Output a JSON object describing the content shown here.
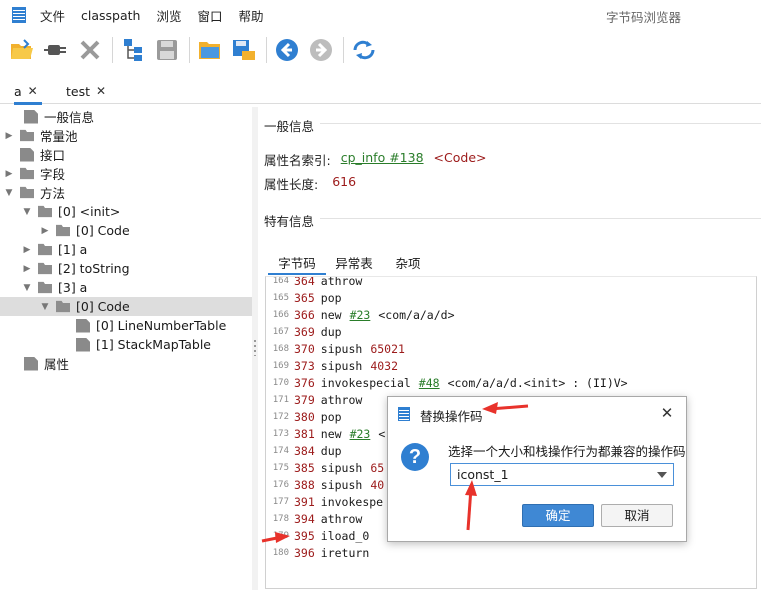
{
  "menu": {
    "items": [
      "文件",
      "classpath",
      "浏览",
      "窗口",
      "帮助"
    ],
    "title": "字节码浏览器"
  },
  "toolbar": {
    "buttons": [
      "open-folder-icon",
      "plugin-icon",
      "close-icon",
      "tree-icon",
      "save-icon",
      "folder-open-icon",
      "save-as-icon",
      "back-icon",
      "forward-icon",
      "refresh-icon"
    ]
  },
  "tabs": [
    {
      "label": "a",
      "close": "✕"
    },
    {
      "label": "test",
      "close": "✕"
    }
  ],
  "tree": {
    "nodes": [
      {
        "label": "一般信息"
      },
      {
        "label": "常量池"
      },
      {
        "label": "接口"
      },
      {
        "label": "字段"
      },
      {
        "label": "方法"
      },
      {
        "label": "[0] <init>"
      },
      {
        "label": "[0] Code"
      },
      {
        "label": "[1] a"
      },
      {
        "label": "[2] toString"
      },
      {
        "label": "[3] a"
      },
      {
        "label": "[0] Code"
      },
      {
        "label": "[0] LineNumberTable"
      },
      {
        "label": "[1] StackMapTable"
      },
      {
        "label": "属性"
      }
    ]
  },
  "general": {
    "title": "一般信息",
    "name_index_label": "属性名索引:",
    "name_index_link": "cp_info #138",
    "name_index_value": "<Code>",
    "length_label": "属性长度:",
    "length_value": "616"
  },
  "specific": {
    "title": "特有信息",
    "subtabs": [
      "字节码",
      "异常表",
      "杂项"
    ]
  },
  "code_lines": [
    {
      "ln": "164",
      "off": "364",
      "op": "athrow",
      "arg": "",
      "cmt": ""
    },
    {
      "ln": "165",
      "off": "365",
      "op": "pop",
      "arg": "",
      "cmt": ""
    },
    {
      "ln": "166",
      "off": "366",
      "op": "new",
      "arg": "#23",
      "cmt": "<com/a/a/d>"
    },
    {
      "ln": "167",
      "off": "369",
      "op": "dup",
      "arg": "",
      "cmt": ""
    },
    {
      "ln": "168",
      "off": "370",
      "op": "sipush",
      "arg": "65021",
      "cmt": ""
    },
    {
      "ln": "169",
      "off": "373",
      "op": "sipush",
      "arg": "4032",
      "cmt": ""
    },
    {
      "ln": "170",
      "off": "376",
      "op": "invokespecial",
      "arg": "#48",
      "cmt": "<com/a/a/d.<init> : (II)V>"
    },
    {
      "ln": "171",
      "off": "379",
      "op": "athrow",
      "arg": "",
      "cmt": ""
    },
    {
      "ln": "172",
      "off": "380",
      "op": "pop",
      "arg": "",
      "cmt": ""
    },
    {
      "ln": "173",
      "off": "381",
      "op": "new",
      "arg": "#23",
      "cmt": "<"
    },
    {
      "ln": "174",
      "off": "384",
      "op": "dup",
      "arg": "",
      "cmt": ""
    },
    {
      "ln": "175",
      "off": "385",
      "op": "sipush",
      "arg": "65",
      "cmt": ""
    },
    {
      "ln": "176",
      "off": "388",
      "op": "sipush",
      "arg": "40",
      "cmt": ""
    },
    {
      "ln": "177",
      "off": "391",
      "op": "invokespe",
      "arg": "",
      "cmt": ""
    },
    {
      "ln": "178",
      "off": "394",
      "op": "athrow",
      "arg": "",
      "cmt": ""
    },
    {
      "ln": "179",
      "off": "395",
      "op": "iload_0",
      "arg": "",
      "cmt": ""
    },
    {
      "ln": "180",
      "off": "396",
      "op": "ireturn",
      "arg": "",
      "cmt": ""
    }
  ],
  "dialog": {
    "title": "替换操作码",
    "close": "✕",
    "message": "选择一个大小和栈操作行为都兼容的操作码",
    "selected": "iconst_1",
    "ok": "确定",
    "cancel": "取消"
  },
  "colors": {
    "accent": "#2f7fd1",
    "link": "#2a7d2a",
    "value": "#9c1a1a",
    "annotation": "#e8322b"
  }
}
